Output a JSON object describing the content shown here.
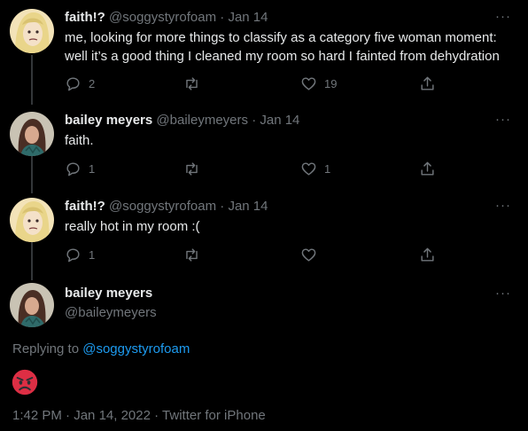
{
  "tweets": [
    {
      "name": "faith!?",
      "handle": "@soggystyrofoam",
      "dot": "·",
      "date": "Jan 14",
      "lines": [
        "me, looking for more things to classify as a category five woman moment:",
        "well it’s a good thing I cleaned my room so hard I fainted from dehydration"
      ],
      "replies": "2",
      "retweets": "",
      "likes": "19"
    },
    {
      "name": "bailey meyers",
      "handle": "@baileymeyers",
      "dot": "·",
      "date": "Jan 14",
      "lines": [
        "faith."
      ],
      "replies": "1",
      "retweets": "",
      "likes": "1"
    },
    {
      "name": "faith!?",
      "handle": "@soggystyrofoam",
      "dot": "·",
      "date": "Jan 14",
      "lines": [
        "really hot in my room :("
      ],
      "replies": "1",
      "retweets": "",
      "likes": ""
    }
  ],
  "main_tweet": {
    "name": "bailey meyers",
    "handle": "@baileymeyers",
    "replying_prefix": "Replying to",
    "replying_to": "@soggystyrofoam",
    "emoji": "angry-face",
    "time": "1:42 PM",
    "date": "Jan 14, 2022",
    "source": "Twitter for iPhone",
    "sep": "·"
  },
  "more_label": "···",
  "colors": {
    "background": "#000000",
    "text": "#e7e9ea",
    "muted": "#71767b",
    "link": "#1d9bf0",
    "thread_line": "#333639"
  }
}
